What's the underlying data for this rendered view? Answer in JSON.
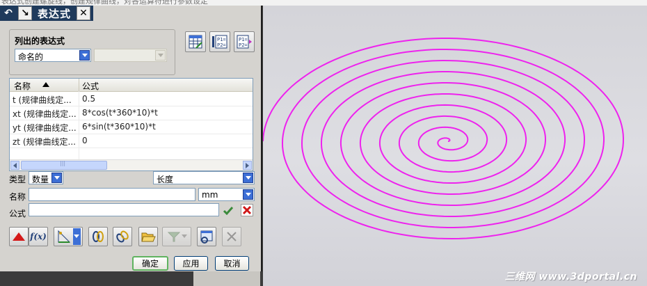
{
  "window": {
    "background_caption": "表达式创建螺旋线，创建规律曲线，对各运算符进行参数设定",
    "title": "表达式"
  },
  "titlebar": {
    "back_glyph": "↶",
    "pin_glyph": "↘",
    "close_glyph": "✕"
  },
  "listed": {
    "group_label": "列出的表达式",
    "filter_value": "命名的",
    "secondary_value": ""
  },
  "table": {
    "columns": [
      "名称",
      "公式"
    ],
    "sort": "ascending",
    "rows": [
      {
        "name": "t  (规律曲线定...",
        "formula": "0.5"
      },
      {
        "name": "xt  (规律曲线定...",
        "formula": "8*cos(t*360*10)*t"
      },
      {
        "name": "yt  (规律曲线定...",
        "formula": "6*sin(t*360*10)*t"
      },
      {
        "name": "zt  (规律曲线定...",
        "formula": "0"
      }
    ],
    "scroll_grip": "|||"
  },
  "form": {
    "type_label": "类型",
    "type_value": "数量",
    "dimension_value": "长度",
    "name_label": "名称",
    "name_value": "",
    "unit_value": "mm",
    "formula_label": "公式",
    "formula_value": ""
  },
  "toolbar": {
    "fx_label": "f(x)"
  },
  "buttons": {
    "ok": "确定",
    "apply": "应用",
    "cancel": "取消"
  },
  "viewport": {
    "curve_color": "#ee22ee",
    "watermark": "三维网 www.3dportal.cn"
  }
}
